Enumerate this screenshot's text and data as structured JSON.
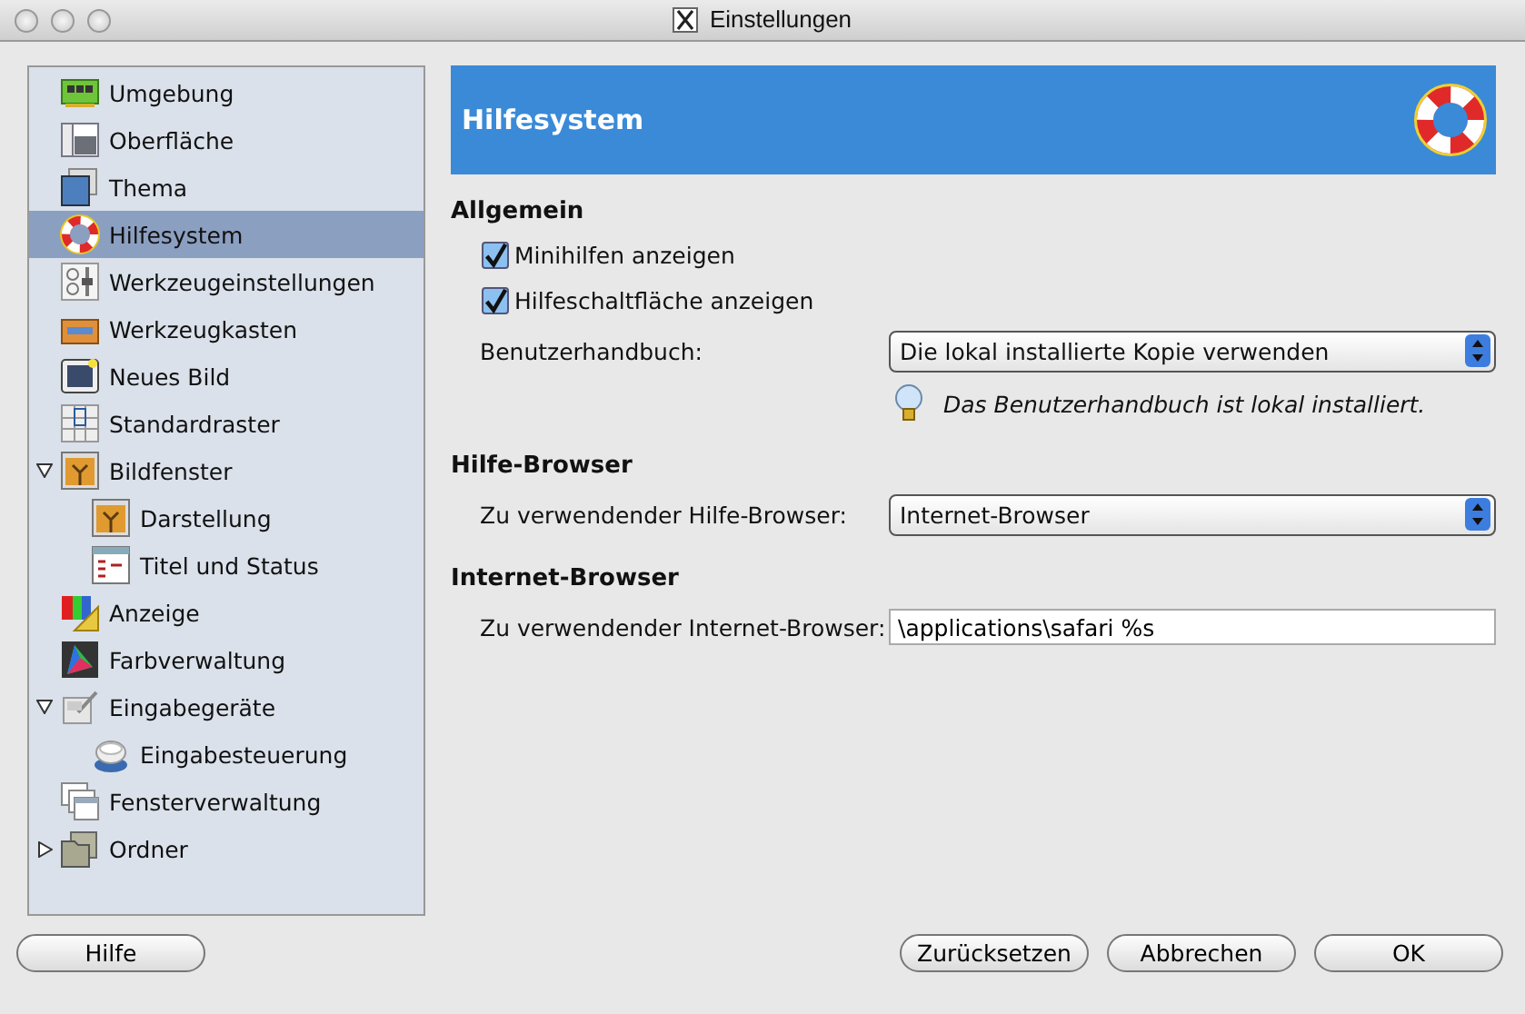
{
  "window": {
    "title": "Einstellungen"
  },
  "sidebar": {
    "items": [
      {
        "label": "Umgebung",
        "selected": false
      },
      {
        "label": "Oberfläche",
        "selected": false
      },
      {
        "label": "Thema",
        "selected": false
      },
      {
        "label": "Hilfesystem",
        "selected": true
      },
      {
        "label": "Werkzeugeinstellungen",
        "selected": false
      },
      {
        "label": "Werkzeugkasten",
        "selected": false
      },
      {
        "label": "Neues Bild",
        "selected": false
      },
      {
        "label": "Standardraster",
        "selected": false
      },
      {
        "label": "Bildfenster",
        "selected": false,
        "expanded": true,
        "children": [
          {
            "label": "Darstellung",
            "selected": false
          },
          {
            "label": "Titel und Status",
            "selected": false
          }
        ]
      },
      {
        "label": "Anzeige",
        "selected": false
      },
      {
        "label": "Farbverwaltung",
        "selected": false
      },
      {
        "label": "Eingabegeräte",
        "selected": false,
        "expanded": true,
        "children": [
          {
            "label": "Eingabesteuerung",
            "selected": false
          }
        ]
      },
      {
        "label": "Fensterverwaltung",
        "selected": false
      },
      {
        "label": "Ordner",
        "selected": false,
        "expanded": false
      }
    ]
  },
  "header": {
    "title": "Hilfesystem"
  },
  "sections": [
    {
      "title": "Allgemein",
      "rows": [
        {
          "kind": "checkbox",
          "label": "Minihilfen anzeigen",
          "checked": true
        },
        {
          "kind": "checkbox",
          "label": "Hilfeschaltfläche anzeigen",
          "checked": true
        },
        {
          "kind": "select",
          "label": "Benutzerhandbuch:",
          "value": "Die lokal installierte Kopie verwenden"
        },
        {
          "kind": "hint",
          "text": "Das Benutzerhandbuch ist lokal installiert."
        }
      ]
    },
    {
      "title": "Hilfe-Browser",
      "rows": [
        {
          "kind": "select",
          "label": "Zu verwendender Hilfe-Browser:",
          "value": "Internet-Browser"
        }
      ]
    },
    {
      "title": "Internet-Browser",
      "rows": [
        {
          "kind": "text",
          "label": "Zu verwendender Internet-Browser:",
          "value": "\\applications\\safari %s"
        }
      ]
    }
  ],
  "buttons_left": [
    "Hilfe"
  ],
  "buttons_right": [
    "Zurücksetzen",
    "Abbrechen",
    "OK"
  ]
}
